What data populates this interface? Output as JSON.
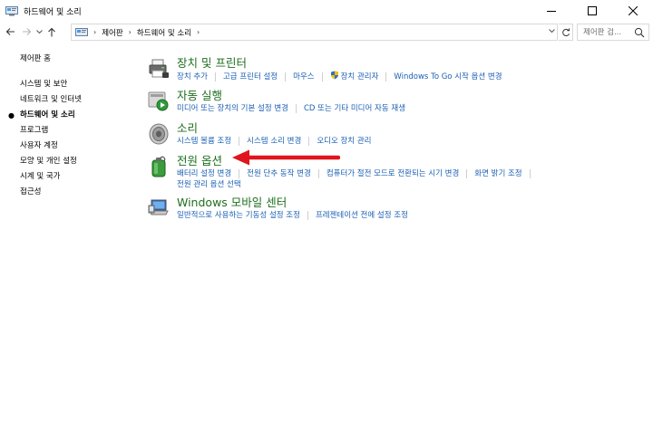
{
  "window": {
    "title": "하드웨어 및 소리"
  },
  "breadcrumb": {
    "items": [
      "제어판",
      "하드웨어 및 소리"
    ]
  },
  "search": {
    "placeholder": "제어판 검..."
  },
  "leftnav": {
    "home": "제어판 홈",
    "items": [
      {
        "label": "시스템 및 보안",
        "current": false
      },
      {
        "label": "네트워크 및 인터넷",
        "current": false
      },
      {
        "label": "하드웨어 및 소리",
        "current": true
      },
      {
        "label": "프로그램",
        "current": false
      },
      {
        "label": "사용자 계정",
        "current": false
      },
      {
        "label": "모양 및 개인 설정",
        "current": false
      },
      {
        "label": "시계 및 국가",
        "current": false
      },
      {
        "label": "접근성",
        "current": false
      }
    ]
  },
  "categories": [
    {
      "title": "장치 및 프린터",
      "icon": "printer-icon",
      "links": [
        "장치 추가",
        "고급 프린터 설정",
        "마우스",
        "장치 관리자",
        "Windows To Go 시작 옵션 변경"
      ]
    },
    {
      "title": "자동 실행",
      "icon": "autoplay-icon",
      "links": [
        "미디어 또는 장치의 기본 설정 변경",
        "CD 또는 기타 미디어 자동 재생"
      ]
    },
    {
      "title": "소리",
      "icon": "speaker-icon",
      "links": [
        "시스템 볼륨 조정",
        "시스템 소리 변경",
        "오디오 장치 관리"
      ]
    },
    {
      "title": "전원 옵션",
      "icon": "battery-icon",
      "links": [
        "배터리 설정 변경",
        "전원 단추 동작 변경",
        "컴퓨터가 절전 모드로 전환되는 시기 변경",
        "화면 밝기 조정"
      ],
      "links2": [
        "전원 관리 옵션 선택"
      ]
    },
    {
      "title": "Windows 모바일 센터",
      "icon": "mobility-center-icon",
      "links": [
        "일반적으로 사용하는 기동성 설정 조정",
        "프레젠테이션 전에 설정 조정"
      ]
    }
  ],
  "colors": {
    "category_title": "#1e6e1e",
    "link": "#1a5fb4",
    "annotation_arrow": "#e0141e"
  }
}
